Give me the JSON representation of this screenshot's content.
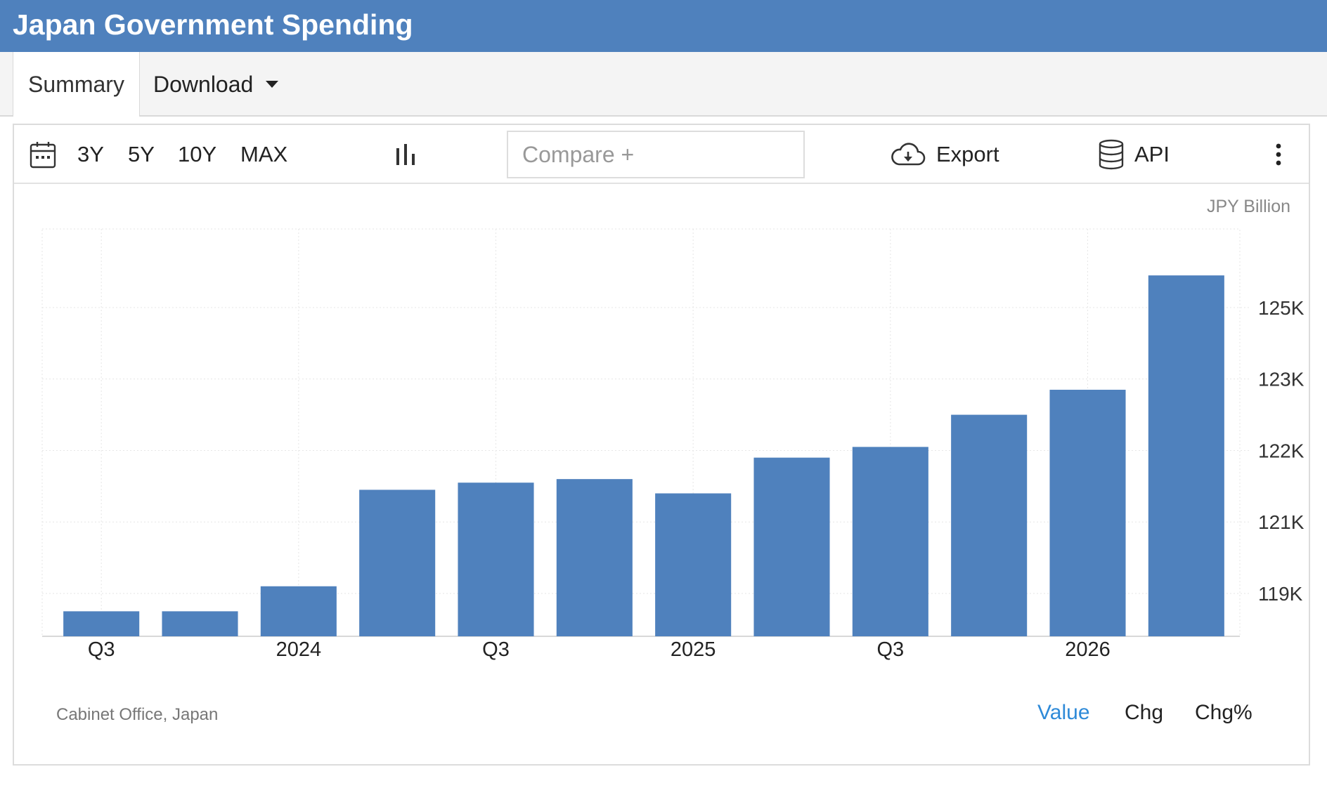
{
  "header": {
    "title": "Japan Government Spending"
  },
  "tabs": {
    "summary": "Summary",
    "download": "Download"
  },
  "toolbar": {
    "ranges": [
      "3Y",
      "5Y",
      "10Y",
      "MAX"
    ],
    "compare_placeholder": "Compare +",
    "export_label": "Export",
    "api_label": "API"
  },
  "icons": {
    "calendar": "calendar-icon",
    "chart_type": "bar-chart-icon",
    "export": "cloud-download-icon",
    "api": "database-icon",
    "more": "more-vertical-icon"
  },
  "colors": {
    "accent": "#4f81bd",
    "bar": "#4f81bd",
    "active_mode": "#2e8ad8"
  },
  "chart_data": {
    "type": "bar",
    "unit": "JPY Billion",
    "categories": [
      "2023 Q3",
      "2023 Q4",
      "2024 Q1",
      "2024 Q2",
      "2024 Q3",
      "2024 Q4",
      "2025 Q1",
      "2025 Q2",
      "2025 Q3",
      "2025 Q4",
      "2026 Q1",
      "2026 Q2"
    ],
    "x_tick_labels": [
      {
        "index": 0,
        "label": "Q3"
      },
      {
        "index": 2,
        "label": "2024"
      },
      {
        "index": 4,
        "label": "Q3"
      },
      {
        "index": 6,
        "label": "2025"
      },
      {
        "index": 8,
        "label": "Q3"
      },
      {
        "index": 10,
        "label": "2026"
      }
    ],
    "values": [
      118.5,
      118.5,
      119.2,
      121.9,
      122.1,
      122.2,
      121.8,
      122.8,
      123.1,
      124.0,
      124.7,
      127.9
    ],
    "y_scale": {
      "ticks": [
        119.0,
        121.0,
        123.0,
        125.0,
        127.0
      ],
      "min": 117.8,
      "max": 129.2
    },
    "y_tick_labels": [
      "119K",
      "121K",
      "122K",
      "123K",
      "125K"
    ],
    "grid": true,
    "legend": "none"
  },
  "footer": {
    "source": "Cabinet Office, Japan",
    "modes": [
      "Value",
      "Chg",
      "Chg%"
    ],
    "active_mode": "Value"
  }
}
